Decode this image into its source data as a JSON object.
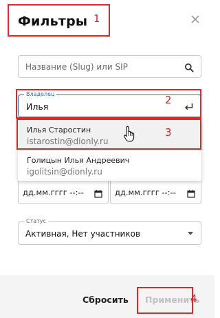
{
  "dialog": {
    "title": "Фильтры"
  },
  "search": {
    "placeholder": "Название (Slug) или SIP"
  },
  "owner": {
    "label": "Владелец",
    "value": "Илья"
  },
  "owner_suggestions": [
    {
      "name": "Илья Старостин",
      "email": "istarostin@dionly.ru",
      "highlighted": true
    },
    {
      "name": "Голицын Илья Андреевич",
      "email": "igolitsin@dionly.ru",
      "highlighted": false
    }
  ],
  "date_range": {
    "from_value": "дд.мм.гггг --:--",
    "to_value": "дд.мм.гггг --:--"
  },
  "status": {
    "label": "Статус",
    "value": "Активная, Нет участников"
  },
  "footer": {
    "reset_label": "Сбросить",
    "apply_label": "Применить"
  },
  "annotations": [
    "1",
    "2",
    "3",
    "4"
  ],
  "colors": {
    "accent": "#2f6fc5",
    "annotation": "#e0262b",
    "footer_bg": "#f4f4f4",
    "disabled_text": "#c2c2c2"
  }
}
